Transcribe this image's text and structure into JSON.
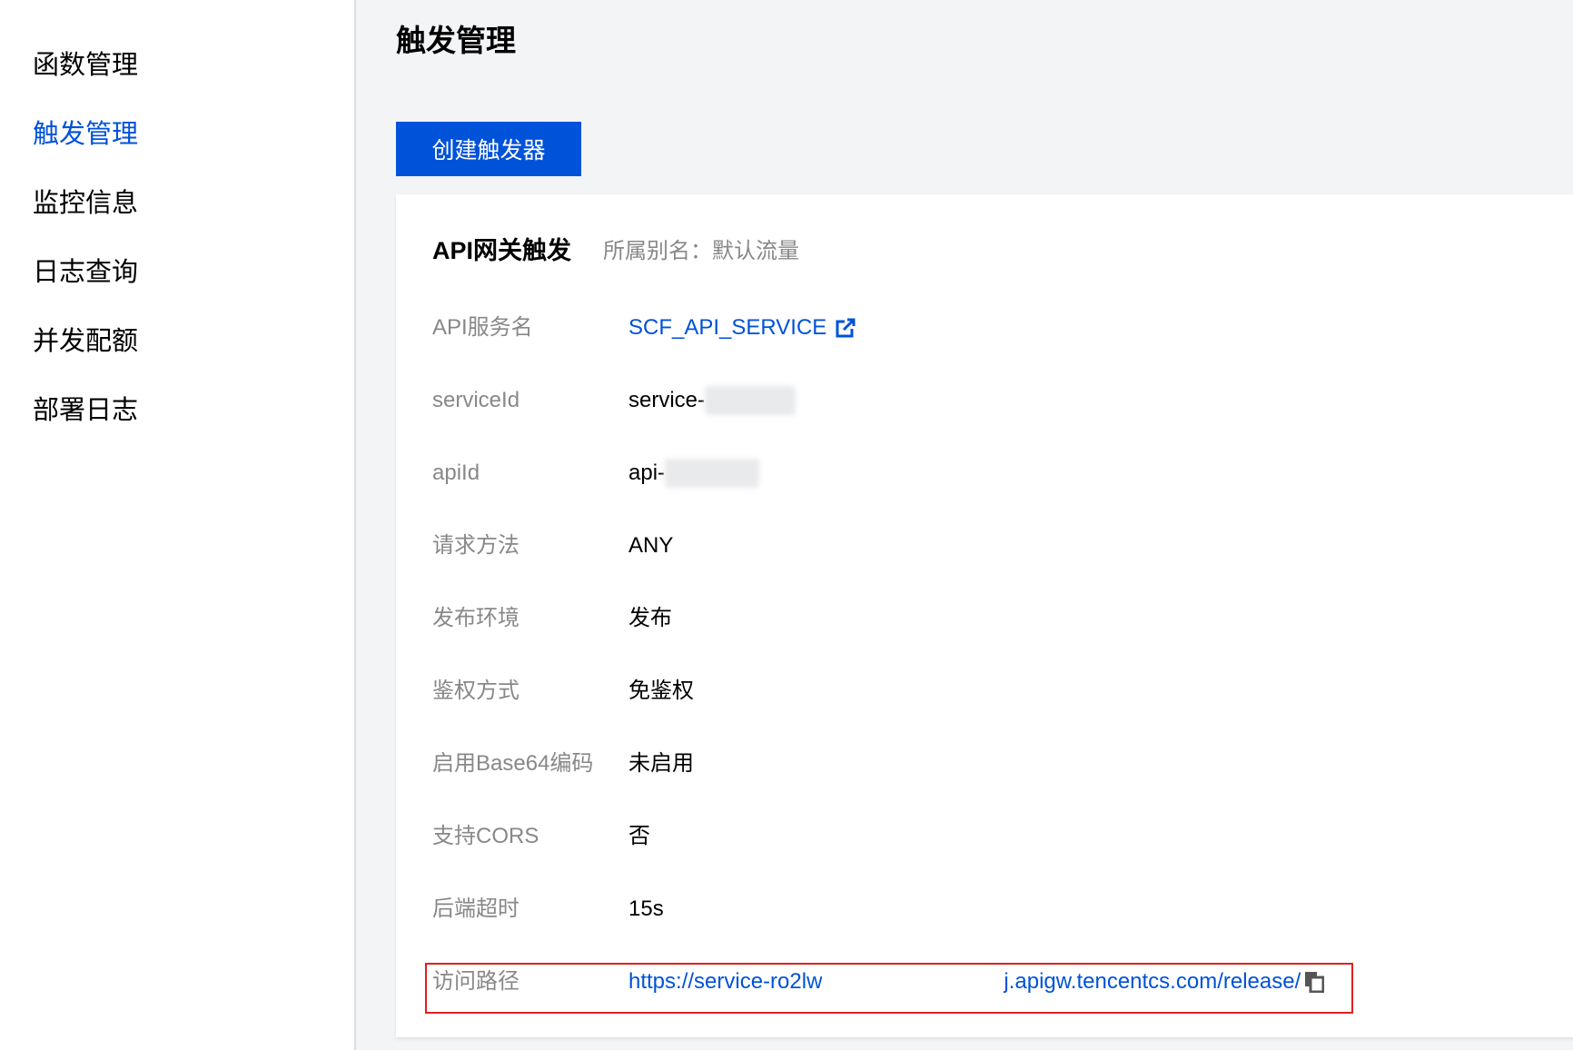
{
  "sidebar": {
    "items": [
      {
        "label": "函数管理",
        "active": false
      },
      {
        "label": "触发管理",
        "active": true
      },
      {
        "label": "监控信息",
        "active": false
      },
      {
        "label": "日志查询",
        "active": false
      },
      {
        "label": "并发配额",
        "active": false
      },
      {
        "label": "部署日志",
        "active": false
      }
    ]
  },
  "page": {
    "title": "触发管理",
    "create_button_label": "创建触发器"
  },
  "trigger_card": {
    "title": "API网关触发",
    "alias": "所属别名：默认流量",
    "rows": [
      {
        "label": "API服务名",
        "value": "SCF_API_SERVICE"
      },
      {
        "label": "serviceId",
        "value": "service-"
      },
      {
        "label": "apiId",
        "value": "api-"
      },
      {
        "label": "请求方法",
        "value": "ANY"
      },
      {
        "label": "发布环境",
        "value": "发布"
      },
      {
        "label": "鉴权方式",
        "value": "免鉴权"
      },
      {
        "label": "启用Base64编码",
        "value": "未启用"
      },
      {
        "label": "支持CORS",
        "value": "否"
      },
      {
        "label": "后端超时",
        "value": "15s"
      },
      {
        "label": "访问路径",
        "value_start": "https://service-ro2lw",
        "value_end": "j.apigw.tencentcs.com/release/"
      }
    ]
  },
  "icons": {
    "external_link": "external-link-icon",
    "copy": "copy-icon"
  },
  "colors": {
    "accent": "#0052d9",
    "highlight_border": "#e02020",
    "label_gray": "#888888"
  }
}
